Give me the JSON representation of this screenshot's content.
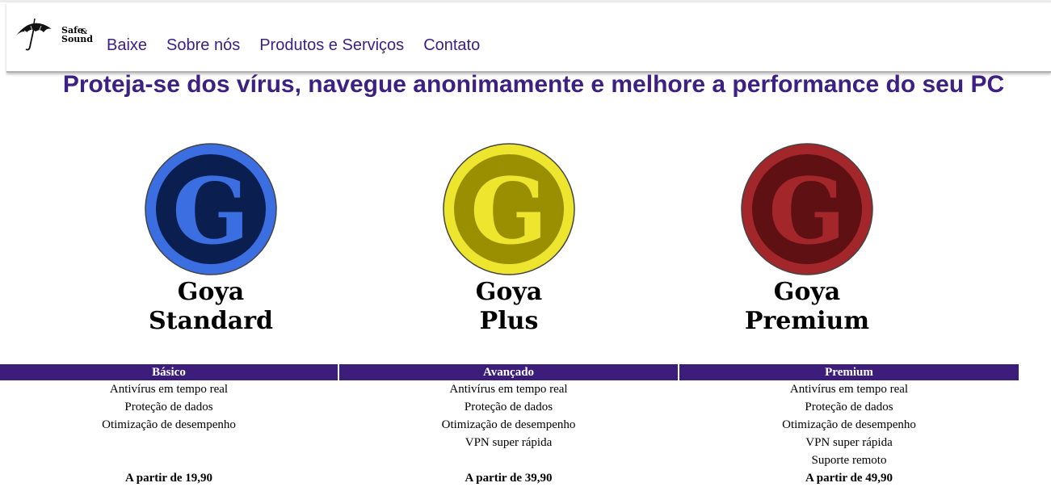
{
  "brand": {
    "line1": "Safe",
    "amp": "&",
    "line2": "Sound"
  },
  "nav": [
    {
      "label": "Baixe"
    },
    {
      "label": "Sobre nós"
    },
    {
      "label": "Produtos e Serviços"
    },
    {
      "label": "Contato"
    }
  ],
  "hero": {
    "title": "Proteja-se dos vírus, navegue anonimamente e melhore a performance do seu PC"
  },
  "products": [
    {
      "letter": "G",
      "name_line1": "Goya",
      "name_line2": "Standard",
      "outer_color": "#3b6ee0",
      "inner_color": "#0a1f50",
      "letter_color": "#3b6ee0"
    },
    {
      "letter": "G",
      "name_line1": "Goya",
      "name_line2": "Plus",
      "outer_color": "#ede52e",
      "inner_color": "#9a8f00",
      "letter_color": "#ede52e"
    },
    {
      "letter": "G",
      "name_line1": "Goya",
      "name_line2": "Premium",
      "outer_color": "#a3262a",
      "inner_color": "#5e1013",
      "letter_color": "#a3262a"
    }
  ],
  "plans": [
    {
      "title": "Básico",
      "features": [
        "Antivírus em tempo real",
        "Proteção de dados",
        "Otimização de desempenho"
      ],
      "price": "A partir de 19,90"
    },
    {
      "title": "Avançado",
      "features": [
        "Antivírus em tempo real",
        "Proteção de dados",
        "Otimização de desempenho",
        "VPN super rápida"
      ],
      "price": "A partir de 39,90"
    },
    {
      "title": "Premium",
      "features": [
        "Antivírus em tempo real",
        "Proteção de dados",
        "Otimização de desempenho",
        "VPN super rápida",
        "Suporte remoto"
      ],
      "price": "A partir de 49,90"
    }
  ],
  "colors": {
    "accent": "#3c2182",
    "table_header": "#3c1e7a"
  }
}
